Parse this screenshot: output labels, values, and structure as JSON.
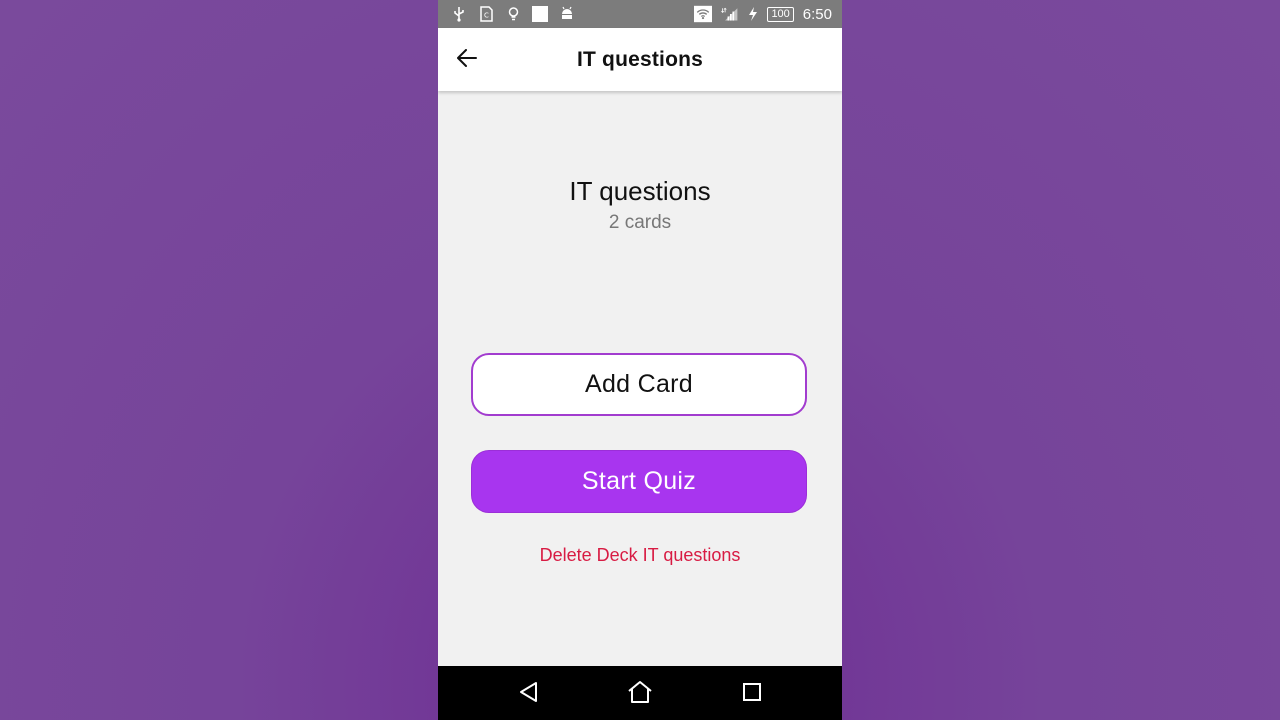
{
  "status_bar": {
    "battery": "100",
    "time": "6:50",
    "left_icons": [
      "usb-icon",
      "sim-card-icon",
      "lightbulb-icon",
      "blank-square-icon",
      "android-icon"
    ],
    "right_icons": [
      "wifi-icon",
      "signal-icon",
      "charging-bolt-icon",
      "battery-icon"
    ]
  },
  "app_bar": {
    "title": "IT questions",
    "back_icon": "arrow-left-icon"
  },
  "deck": {
    "title": "IT questions",
    "count": "2 cards"
  },
  "actions": {
    "add_card": "Add Card",
    "start_quiz": "Start Quiz",
    "delete_deck": "Delete Deck IT questions"
  },
  "nav_bar": {
    "icons": [
      "back-triangle-icon",
      "home-icon",
      "recents-icon"
    ]
  },
  "colors": {
    "accent": "#a835ef",
    "outline": "#a23ccf",
    "danger": "#d81b43",
    "background": "#7a4a9c"
  }
}
